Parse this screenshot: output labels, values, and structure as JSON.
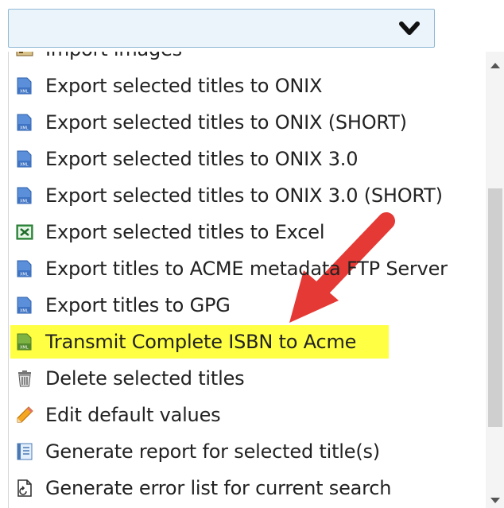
{
  "select": {
    "icon": "chevron-down-icon"
  },
  "menu": {
    "items": [
      {
        "label": "Import images",
        "icon": "image-import-icon"
      },
      {
        "label": "Export selected titles to ONIX",
        "icon": "xml-file-icon"
      },
      {
        "label": "Export selected titles to ONIX (SHORT)",
        "icon": "xml-file-icon"
      },
      {
        "label": "Export selected titles to ONIX 3.0",
        "icon": "xml-file-icon"
      },
      {
        "label": "Export selected titles to ONIX 3.0 (SHORT)",
        "icon": "xml-file-icon"
      },
      {
        "label": "Export selected titles to Excel",
        "icon": "excel-file-icon"
      },
      {
        "label": "Export titles to ACME metadata FTP Server",
        "icon": "xml-file-icon"
      },
      {
        "label": "Export titles to GPG",
        "icon": "xml-file-icon"
      },
      {
        "label": "Transmit Complete ISBN to Acme",
        "icon": "transmit-file-icon",
        "highlighted": true
      },
      {
        "label": "Delete selected titles",
        "icon": "trash-icon"
      },
      {
        "label": "Edit default values",
        "icon": "pencil-icon"
      },
      {
        "label": "Generate report for selected title(s)",
        "icon": "report-icon"
      },
      {
        "label": "Generate error list for current search",
        "icon": "error-list-icon"
      }
    ]
  },
  "annotation": {
    "icon": "red-arrow-icon",
    "color": "#e53935"
  },
  "colors": {
    "highlight": "#ffff44",
    "select_bg": "#eaf4fa",
    "select_border": "#8fb9d6"
  }
}
